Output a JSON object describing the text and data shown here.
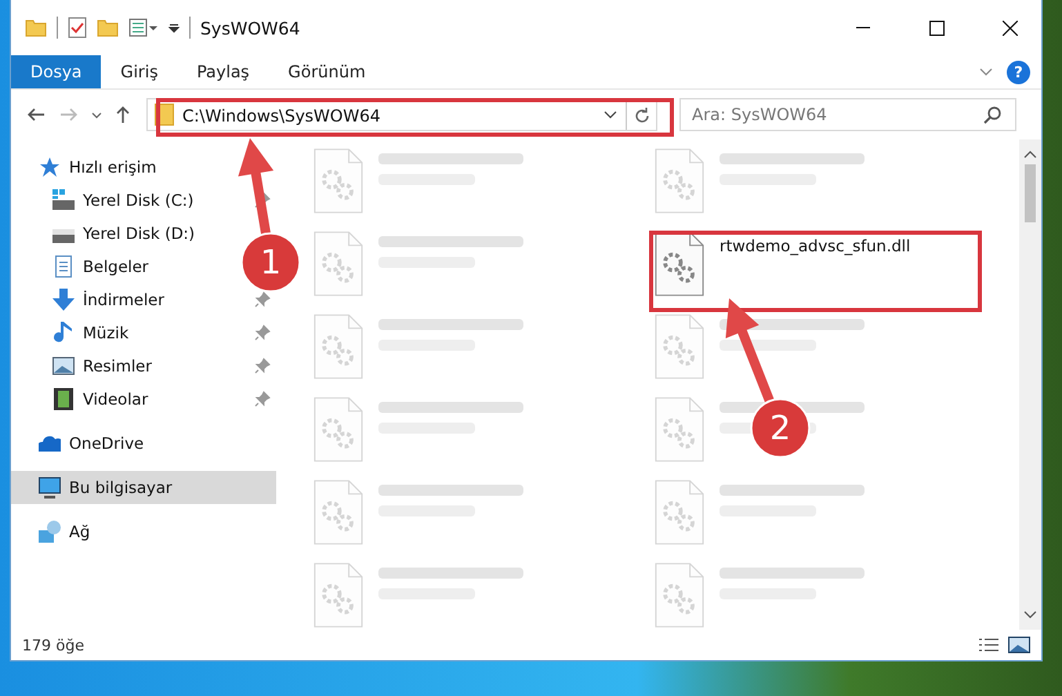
{
  "window": {
    "title": "SysWOW64"
  },
  "ribbon_tabs": [
    {
      "label": "Dosya",
      "selected": true
    },
    {
      "label": "Giriş",
      "selected": false
    },
    {
      "label": "Paylaş",
      "selected": false
    },
    {
      "label": "Görünüm",
      "selected": false
    }
  ],
  "help_button": "?",
  "address_bar": {
    "path": "C:\\Windows\\SysWOW64"
  },
  "search": {
    "placeholder": "Ara: SysWOW64"
  },
  "sidebar": {
    "items": [
      {
        "label": "Hızlı erişim",
        "selected": false,
        "children": [
          {
            "label": "Yerel Disk (C:)",
            "selected": false,
            "pinned": true
          },
          {
            "label": "Yerel Disk (D:)",
            "selected": false,
            "pinned": false
          },
          {
            "label": "Belgeler",
            "selected": false,
            "pinned": false
          },
          {
            "label": "İndirmeler",
            "selected": false,
            "pinned": true
          },
          {
            "label": "Müzik",
            "selected": false,
            "pinned": true
          },
          {
            "label": "Resimler",
            "selected": false,
            "pinned": true
          },
          {
            "label": "Videolar",
            "selected": false,
            "pinned": true
          }
        ]
      },
      {
        "label": "OneDrive",
        "selected": false
      },
      {
        "label": "Bu bilgisayar",
        "selected": true
      },
      {
        "label": "Ağ",
        "selected": false
      }
    ]
  },
  "files": [
    {
      "kind": "blurred"
    },
    {
      "kind": "blurred"
    },
    {
      "kind": "blurred"
    },
    {
      "kind": "focus",
      "name": "rtwdemo_advsc_sfun.dll"
    },
    {
      "kind": "blurred"
    },
    {
      "kind": "blurred"
    },
    {
      "kind": "blurred"
    },
    {
      "kind": "blurred"
    },
    {
      "kind": "blurred"
    },
    {
      "kind": "blurred"
    },
    {
      "kind": "blurred"
    },
    {
      "kind": "blurred"
    }
  ],
  "status_bar": {
    "count": "179 öğe"
  },
  "annotations": [
    {
      "label": "1"
    },
    {
      "label": "2"
    }
  ]
}
